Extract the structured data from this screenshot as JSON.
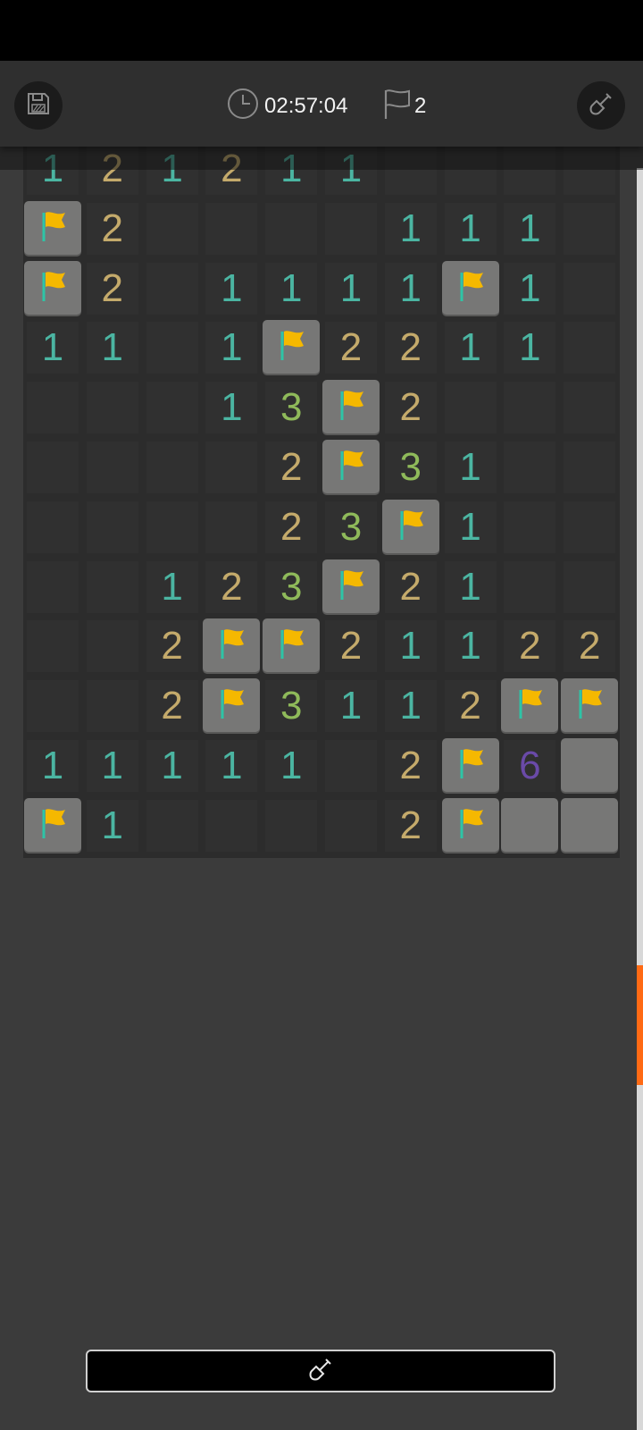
{
  "toolbar": {
    "save_icon": "floppy-disk-icon",
    "clock_icon": "clock-icon",
    "timer": "02:57:04",
    "flag_icon": "flag-outline-icon",
    "flag_count": "2",
    "mode_icon": "shovel-icon"
  },
  "board": {
    "columns": 10,
    "rows": 12,
    "legend": "digit = revealed number, F = flagged cell, C = covered cell, _ = empty revealed cell",
    "grid": [
      [
        "1",
        "2",
        "1",
        "2",
        "1",
        "1",
        "_",
        "_",
        "_",
        "_"
      ],
      [
        "F",
        "2",
        "_",
        "_",
        "_",
        "_",
        "1",
        "1",
        "1",
        "_"
      ],
      [
        "F",
        "2",
        "_",
        "1",
        "1",
        "1",
        "1",
        "F",
        "1",
        "_"
      ],
      [
        "1",
        "1",
        "_",
        "1",
        "F",
        "2",
        "2",
        "1",
        "1",
        "_"
      ],
      [
        "_",
        "_",
        "_",
        "1",
        "3",
        "F",
        "2",
        "_",
        "_",
        "_"
      ],
      [
        "_",
        "_",
        "_",
        "_",
        "2",
        "F",
        "3",
        "1",
        "_",
        "_"
      ],
      [
        "_",
        "_",
        "_",
        "_",
        "2",
        "3",
        "F",
        "1",
        "_",
        "_"
      ],
      [
        "_",
        "_",
        "1",
        "2",
        "3",
        "F",
        "2",
        "1",
        "_",
        "_"
      ],
      [
        "_",
        "_",
        "2",
        "F",
        "F",
        "2",
        "1",
        "1",
        "2",
        "2"
      ],
      [
        "_",
        "_",
        "2",
        "F",
        "3",
        "1",
        "1",
        "2",
        "F",
        "F"
      ],
      [
        "1",
        "1",
        "1",
        "1",
        "1",
        "_",
        "2",
        "F",
        "6",
        "C"
      ],
      [
        "F",
        "1",
        "_",
        "_",
        "_",
        "_",
        "2",
        "F",
        "C",
        "C"
      ]
    ],
    "colors": {
      "1": "#4bb5a2",
      "2": "#c4aa6b",
      "3": "#8fba5a",
      "6": "#6a4aa8",
      "flag": "#f5b800",
      "flag_pole": "#2ec4a6"
    }
  },
  "scrollbar": {
    "accent": "#ff6a14"
  },
  "action_bar": {
    "icon": "shovel-icon"
  }
}
